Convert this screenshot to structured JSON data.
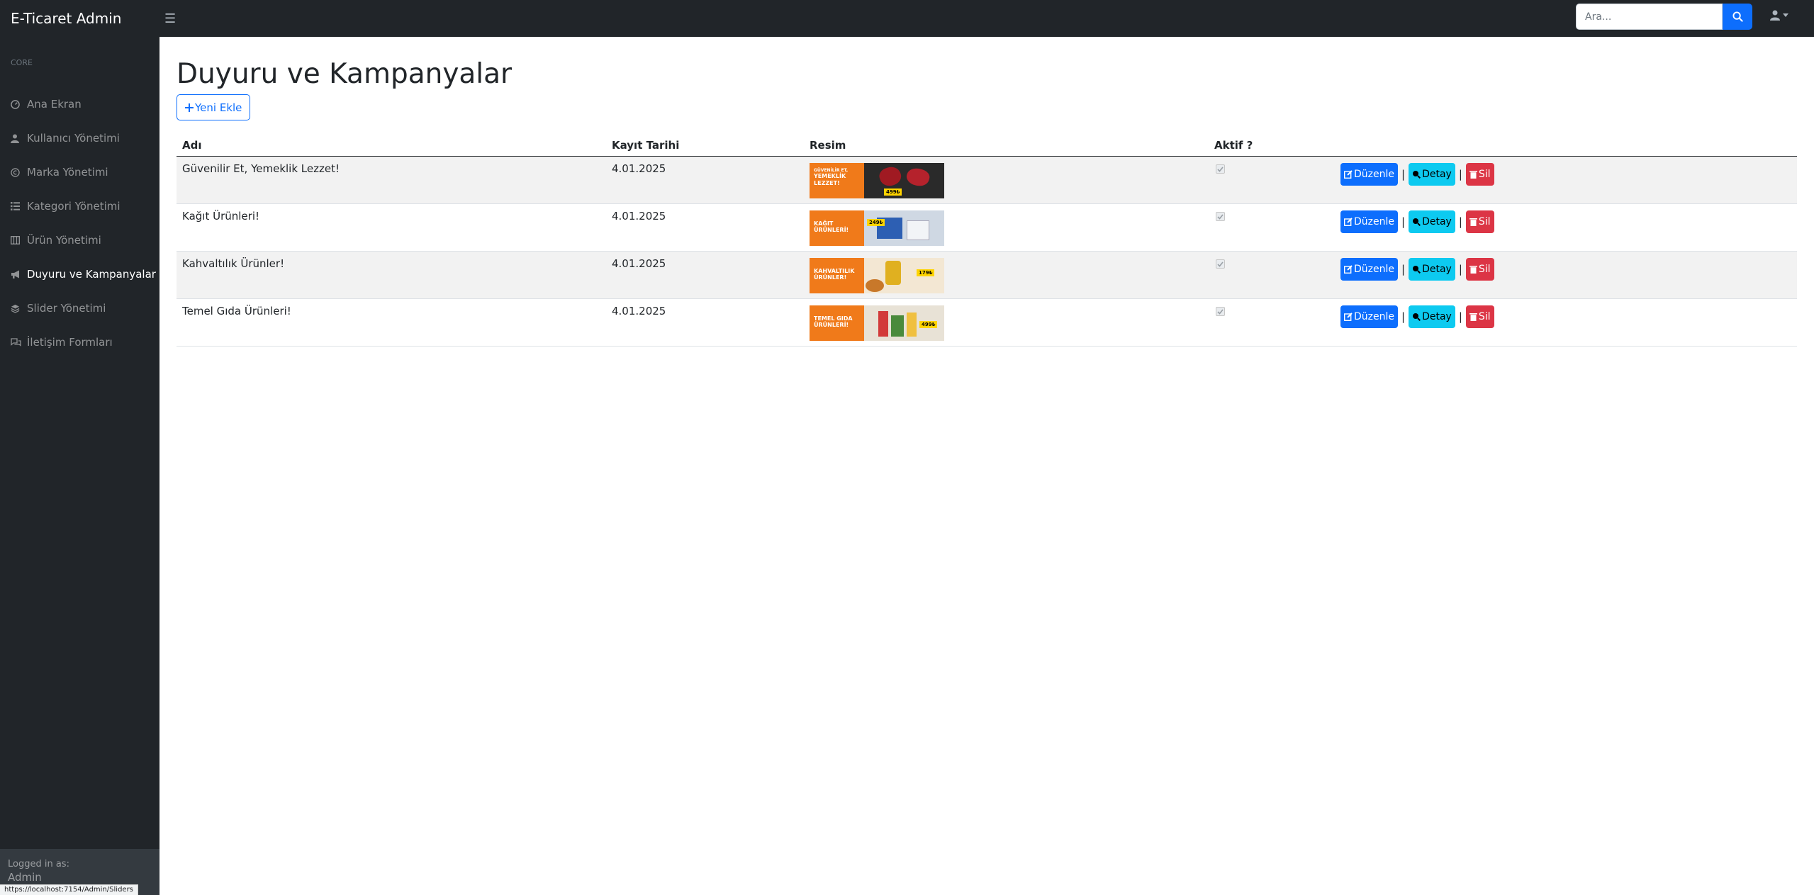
{
  "app": {
    "brand": "E-Ticaret Admin"
  },
  "search": {
    "placeholder": "Ara..."
  },
  "sidebar": {
    "heading": "CORE",
    "items": [
      {
        "label": "Ana Ekran",
        "icon": "dashboard-icon"
      },
      {
        "label": "Kullanıcı Yönetimi",
        "icon": "user-icon"
      },
      {
        "label": "Marka Yönetimi",
        "icon": "copyright-icon"
      },
      {
        "label": "Kategori Yönetimi",
        "icon": "list-icon"
      },
      {
        "label": "Ürün Yönetimi",
        "icon": "table-columns-icon"
      },
      {
        "label": "Duyuru ve Kampanyalar",
        "icon": "bullhorn-icon",
        "active": true
      },
      {
        "label": "Slider Yönetimi",
        "icon": "layers-icon"
      },
      {
        "label": "İletişim Formları",
        "icon": "comments-icon"
      }
    ],
    "footer": {
      "label": "Logged in as:",
      "user": "Admin"
    }
  },
  "main": {
    "title": "Duyuru ve Kampanyalar",
    "add_button": "Yeni Ekle",
    "table": {
      "headers": [
        "Adı",
        "Kayıt Tarihi",
        "Resim",
        "Aktif ?",
        ""
      ],
      "rows": [
        {
          "name": "Güvenilir Et, Yemeklik Lezzet!",
          "date": "4.01.2025",
          "active": true,
          "image_text_small": "GÜVENİLİR ET,",
          "image_text": "YEMEKLİK LEZZET!",
          "image_tag": "499₺"
        },
        {
          "name": "Kağıt Ürünleri!",
          "date": "4.01.2025",
          "active": true,
          "image_text_small": "",
          "image_text": "KAĞIT ÜRÜNLERİ!",
          "image_tag": "249₺"
        },
        {
          "name": "Kahvaltılık Ürünler!",
          "date": "4.01.2025",
          "active": true,
          "image_text_small": "",
          "image_text": "KAHVALTILIK ÜRÜNLER!",
          "image_tag": "179₺"
        },
        {
          "name": "Temel Gıda Ürünleri!",
          "date": "4.01.2025",
          "active": true,
          "image_text_small": "",
          "image_text": "TEMEL GIDA ÜRÜNLERİ!",
          "image_tag": "499₺"
        }
      ],
      "actions": {
        "edit": "Düzenle",
        "detail": "Detay",
        "delete": "Sil",
        "separator": "|"
      }
    }
  },
  "statusbar": {
    "url": "https://localhost:7154/Admin/Sliders"
  },
  "colors": {
    "nav_bg": "#212529",
    "primary": "#0d6efd",
    "info": "#0dcaf0",
    "danger": "#dc3545",
    "banner_orange": "#f07a1a"
  }
}
